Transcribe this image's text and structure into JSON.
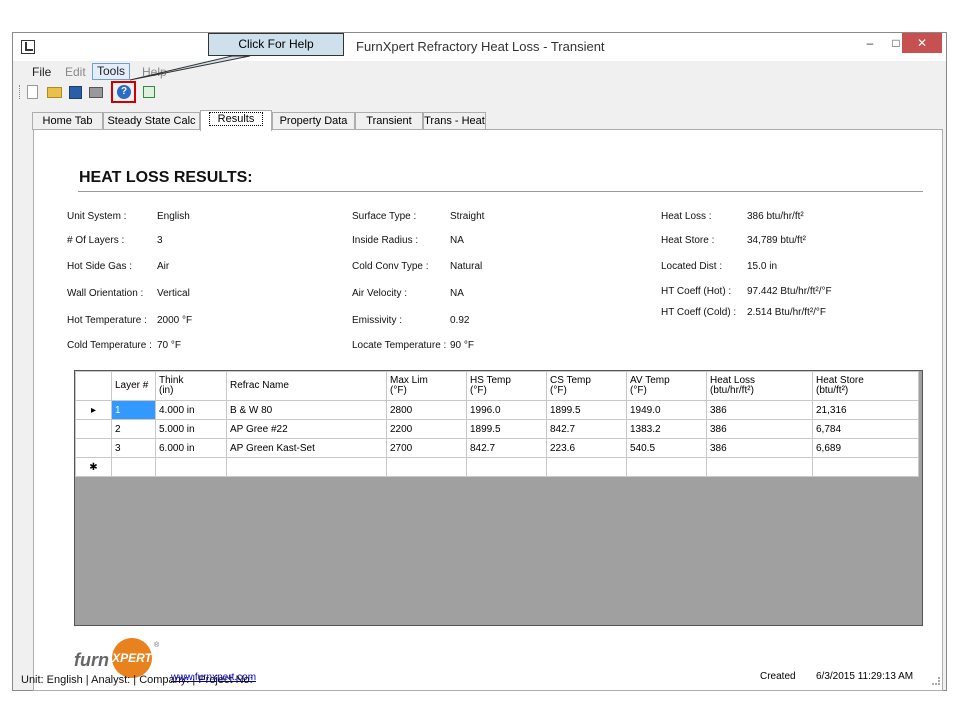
{
  "window": {
    "title": "FurnXpert Refractory Heat Loss - Transient",
    "min": "–",
    "max": "□",
    "close": "✕"
  },
  "callout": {
    "text": "Click For Help"
  },
  "menu": {
    "file": "File",
    "edit": "Edit",
    "tools": "Tools",
    "help": "Help"
  },
  "toolbar": {
    "help_icon": "?"
  },
  "tabs": [
    "Home Tab",
    "Steady State Calc",
    "Results",
    "Property Data",
    "Transient",
    "Trans - Heat"
  ],
  "results": {
    "title": "HEAT LOSS RESULTS:",
    "col1": [
      {
        "label": "Unit System :",
        "value": "English"
      },
      {
        "label": "# Of Layers :",
        "value": "3"
      },
      {
        "label": "Hot Side Gas :",
        "value": "Air"
      },
      {
        "label": "Wall Orientation :",
        "value": "Vertical"
      },
      {
        "label": "Hot Temperature :",
        "value": "2000 °F"
      },
      {
        "label": "Cold Temperature :",
        "value": "70 °F"
      }
    ],
    "col2": [
      {
        "label": "Surface Type :",
        "value": "Straight"
      },
      {
        "label": "Inside Radius :",
        "value": "NA"
      },
      {
        "label": "Cold Conv Type :",
        "value": "Natural"
      },
      {
        "label": "Air Velocity :",
        "value": "NA"
      },
      {
        "label": "Emissivity :",
        "value": "0.92"
      },
      {
        "label": "Locate Temperature :",
        "value": "90 °F"
      }
    ],
    "col3": [
      {
        "label": "Heat Loss :",
        "value": "386 btu/hr/ft²"
      },
      {
        "label": "Heat Store :",
        "value": "34,789 btu/ft²"
      },
      {
        "label": "Located Dist :",
        "value": "15.0 in"
      },
      {
        "label": "HT Coeff (Hot) :",
        "value": "97.442 Btu/hr/ft²/°F"
      },
      {
        "label": "HT Coeff (Cold) :",
        "value": "2.514 Btu/hr/ft²/°F"
      }
    ]
  },
  "grid": {
    "headers": [
      [
        "Layer #",
        ""
      ],
      [
        "Think",
        "(in)"
      ],
      [
        "Refrac Name",
        ""
      ],
      [
        "Max Lim",
        "(°F)"
      ],
      [
        "HS Temp",
        "(°F)"
      ],
      [
        "CS Temp",
        "(°F)"
      ],
      [
        "AV Temp",
        "(°F)"
      ],
      [
        "Heat Loss",
        "(btu/hr/ft²)"
      ],
      [
        "Heat Store",
        "(btu/ft²)"
      ]
    ],
    "rows": [
      {
        "marker": "▸",
        "cells": [
          "1",
          "4.000 in",
          "B & W 80",
          "2800",
          "1996.0",
          "1899.5",
          "1949.0",
          "386",
          "21,316"
        ]
      },
      {
        "marker": "",
        "cells": [
          "2",
          "5.000 in",
          "AP Gree #22",
          "2200",
          "1899.5",
          "842.7",
          "1383.2",
          "386",
          "6,784"
        ]
      },
      {
        "marker": "",
        "cells": [
          "3",
          "6.000 in",
          "AP Green Kast-Set",
          "2700",
          "842.7",
          "223.6",
          "540.5",
          "386",
          "6,689"
        ]
      }
    ],
    "new_row_marker": "✱"
  },
  "footer": {
    "logo_text": "furn",
    "logo_x": "XPERT",
    "logo_reg": "®",
    "link": "www.furnxpert.com",
    "created_label": "Created",
    "created_value": "6/3/2015 11:29:13 AM"
  },
  "statusbar": {
    "text": "Unit: English  | Analyst:   | Company:   | Project No:"
  }
}
